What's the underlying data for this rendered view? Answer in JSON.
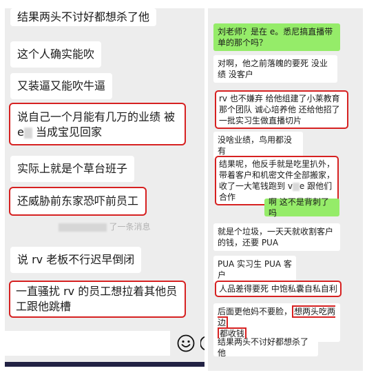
{
  "left_chat": {
    "messages": [
      "结果两头不讨好都想杀了他",
      "这个人确实能吹",
      "又装逼又能吹牛逼",
      "说自己一个月能有几万的业绩 被",
      "当成宝见回家",
      "实际上就是个草台班子",
      "还威胁前东家恐吓前员工",
      "说 rv 老板不行迟早倒闭",
      "一直骚扰 rv 的员工想拉着其他员工跟他跳槽"
    ],
    "message_prefix_e": "e",
    "recall_notice": "了一条消息"
  },
  "right_chat": {
    "msg1": "刘老师？是在 e。悉尼搞直播带单的那个吗？",
    "msg2": "对啊，他之前落魄的要死 没业绩 没客户",
    "msg3": "rv 也不嫌弃 给他组建了小莱教育那个团队 诚心培养他 还给他招了一批实习生做直播切片",
    "msg4": "没啥业绩，鸟用都没有",
    "msg5a": "结果呢，他反手就是吃里扒外，带着客户和机密文件全部搬家，收了一大笔钱跑到 v",
    "msg5b": "e 跟他们合作",
    "msg6": "啊 这不是背刺了吗",
    "msg7": "就是个垃圾，一天天就收割客户的钱，还要 PUA",
    "msg8": "PUA 实习生 PUA 客户",
    "msg9": "人品差得要死 中饱私囊自私自利",
    "msg10_plain": "后面更他妈不要脸，",
    "msg10_hl1": "想两头吃两边",
    "msg10_hl2": "都收钱",
    "msg11": "结果两头不讨好都想杀了他"
  },
  "icons": {
    "emoji": "emoji-icon",
    "plus": "plus-icon"
  }
}
